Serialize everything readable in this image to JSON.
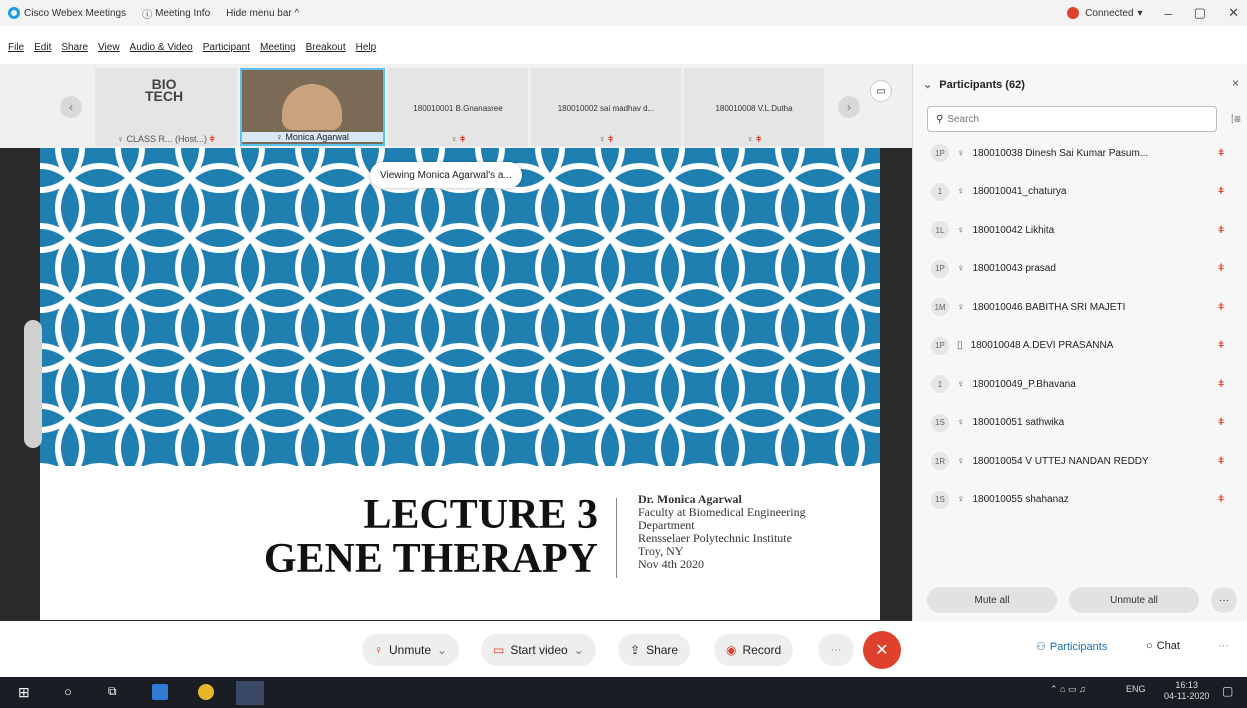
{
  "titlebar": {
    "app_name": "Cisco Webex Meetings",
    "meeting_info": "Meeting Info",
    "hide_menu": "Hide menu bar ^",
    "connected": "Connected",
    "minimize": "–",
    "restore": "▢",
    "close": "✕"
  },
  "menu": [
    "File",
    "Edit",
    "Share",
    "View",
    "Audio & Video",
    "Participant",
    "Meeting",
    "Breakout",
    "Help"
  ],
  "filmstrip": {
    "tiles": [
      {
        "name": "CLASS R... (Host...)",
        "logo": "BIO\nTECH"
      },
      {
        "name": "Monica Agarwal"
      },
      {
        "name": "180010001 B.Gnanasree"
      },
      {
        "name": "180010002 sai madhav d..."
      },
      {
        "name": "180010008 V.L.Dutha"
      }
    ]
  },
  "viewing": "Viewing Monica Agarwal's a...",
  "slide": {
    "title_line1": "LECTURE 3",
    "title_line2": "GENE THERAPY",
    "presenter_name": "Dr. Monica Agarwal",
    "presenter_line2": "Faculty at Biomedical Engineering",
    "presenter_line3": "Department",
    "presenter_line4": "Rensselaer Polytechnic Institute",
    "presenter_line5": "Troy, NY",
    "presenter_line6": "Nov 4th 2020"
  },
  "panel": {
    "title": "Participants (62)",
    "search_placeholder": "Search",
    "participants": [
      {
        "initials": "1P",
        "name": "180010038 Dinesh Sai Kumar Pasum..."
      },
      {
        "initials": "1",
        "name": "180010041_chaturya"
      },
      {
        "initials": "1L",
        "name": "180010042 Likhita"
      },
      {
        "initials": "1P",
        "name": "180010043 prasad"
      },
      {
        "initials": "1M",
        "name": "180010046 BABITHA SRI MAJETI"
      },
      {
        "initials": "1P",
        "name": "180010048 A.DEVI PRASANNA"
      },
      {
        "initials": "1",
        "name": "180010049_P.Bhavana"
      },
      {
        "initials": "1S",
        "name": "180010051 sathwika"
      },
      {
        "initials": "1R",
        "name": "180010054 V UTTEJ NANDAN REDDY"
      },
      {
        "initials": "1S",
        "name": "180010055 shahanaz"
      }
    ],
    "mute_all": "Mute all",
    "unmute_all": "Unmute all"
  },
  "controls": {
    "unmute": "Unmute",
    "start_video": "Start video",
    "share": "Share",
    "record": "Record",
    "participants": "Participants",
    "chat": "Chat"
  },
  "taskbar": {
    "lang": "ENG",
    "time": "16:13",
    "date": "04-11-2020"
  }
}
